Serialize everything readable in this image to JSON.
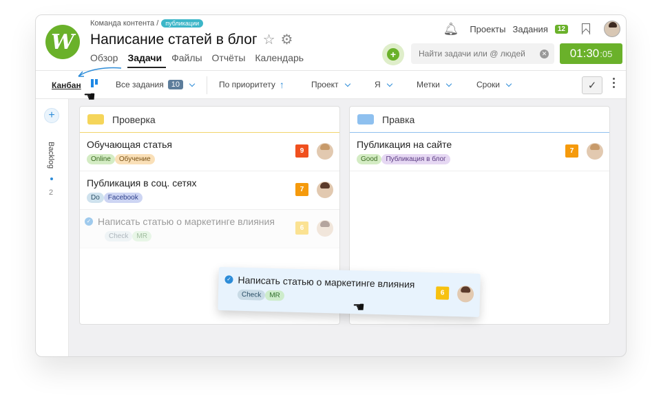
{
  "header": {
    "breadcrumb": "Команда контента /",
    "breadcrumb_badge": "публикации",
    "title": "Написание статей в блог",
    "tabs": [
      {
        "label": "Обзор",
        "active": false
      },
      {
        "label": "Задачи",
        "active": true
      },
      {
        "label": "Файлы",
        "active": false
      },
      {
        "label": "Отчёты",
        "active": false
      },
      {
        "label": "Календарь",
        "active": false
      }
    ],
    "projects_link": "Проекты",
    "tasks_link": "Задания",
    "tasks_count": "12",
    "search_placeholder": "Найти задачи или @ людей",
    "timer_main": "01:30",
    "timer_sec": ":05"
  },
  "toolbar": {
    "view_label": "Канбан",
    "all_tasks": "Все задания",
    "all_tasks_count": "10",
    "sort": "По приоритету",
    "project": "Проект",
    "me": "Я",
    "tags": "Метки",
    "deadlines": "Сроки"
  },
  "side": {
    "label": "Backlog",
    "count": "2"
  },
  "columns": [
    {
      "title": "Проверка",
      "color": "#f5d55a",
      "cards": [
        {
          "title": "Обучающая статья",
          "tags": [
            "Online",
            "Обучение"
          ],
          "priority": "9",
          "priority_color": "#f0501e"
        },
        {
          "title": "Публикация в соц. сетях",
          "tags": [
            "Do",
            "Facebook"
          ],
          "priority": "7",
          "priority_color": "#f59a0c"
        },
        {
          "title": "Написать статью о маркетинге влияния",
          "tags": [
            "Check",
            "MR"
          ],
          "priority": "6",
          "priority_color": "#f7c10f",
          "ghost": true
        }
      ]
    },
    {
      "title": "Правка",
      "color": "#8ec0ef",
      "cards": [
        {
          "title": "Публикация на сайте",
          "tags": [
            "Good",
            "Публикация в блог"
          ],
          "priority": "7",
          "priority_color": "#f59a0c"
        }
      ]
    }
  ],
  "dragged_card": {
    "title": "Написать статью о маркетинге влияния",
    "tags": [
      "Check",
      "MR"
    ],
    "priority": "6",
    "priority_color": "#f7c10f"
  },
  "colors": {
    "brand_green": "#6ab12a",
    "accent_blue": "#2d8cd8"
  }
}
